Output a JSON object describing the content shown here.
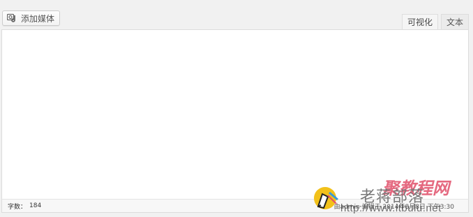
{
  "toolbar": {
    "add_media_label": "添加媒体",
    "add_media_icon": "media-icon"
  },
  "editor_tabs": {
    "visual": "可视化",
    "text": "文本"
  },
  "editor": {
    "content": ""
  },
  "status": {
    "word_count_label": "字数：",
    "word_count_value": "184",
    "draft_note": "由admin 编辑于 2014年8月8日 下午3:30"
  },
  "watermark": {
    "site_name": "老蒋部落",
    "brand": "聚教程网",
    "url": "http://www.itbulu.net"
  }
}
